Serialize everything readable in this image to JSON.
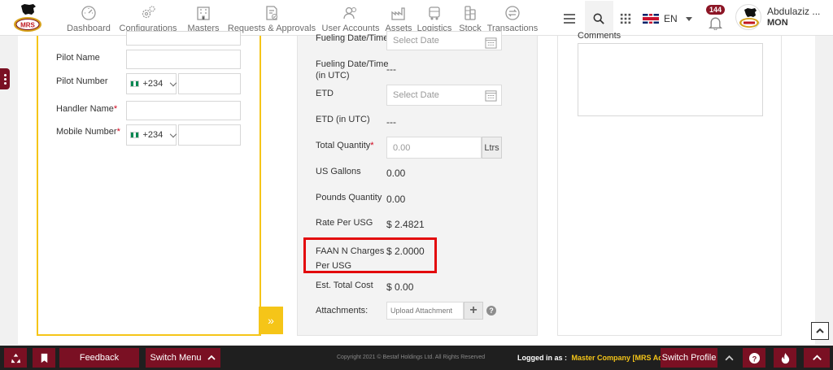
{
  "brand": {
    "logo_text": "MRS",
    "colors": {
      "maroon": "#7a1023",
      "accent_yellow": "#f5c518",
      "highlight_red": "#e3090c"
    }
  },
  "nav": {
    "items": [
      {
        "label": "Dashboard",
        "icon": "dashboard-icon"
      },
      {
        "label": "Configurations",
        "icon": "gears-icon"
      },
      {
        "label": "Masters",
        "icon": "building-icon"
      },
      {
        "label": "Requests & Approvals",
        "icon": "document-check-icon"
      },
      {
        "label": "User Accounts",
        "icon": "users-icon"
      },
      {
        "label": "Assets",
        "icon": "factory-icon"
      },
      {
        "label": "Logistics",
        "icon": "truck-icon"
      },
      {
        "label": "Stock",
        "icon": "barrels-icon"
      },
      {
        "label": "Transactions",
        "icon": "exchange-icon"
      }
    ]
  },
  "header": {
    "language": "EN",
    "notifications_count": "144",
    "user_name": "Abdulaziz ...",
    "user_code": "MON"
  },
  "left_form": {
    "pilot_name_label": "Pilot Name",
    "pilot_number_label": "Pilot Number",
    "pilot_number_code": "+234",
    "handler_name_label": "Handler Name",
    "mobile_number_label": "Mobile Number",
    "mobile_number_code": "+234",
    "collapse_glyph": "»"
  },
  "mid_form": {
    "fueling_datetime_label": "Fueling Date/Time",
    "fueling_datetime_placeholder": "Select Date",
    "fueling_datetime_utc_label_1": "Fueling Date/Time",
    "fueling_datetime_utc_label_2": "(in UTC)",
    "fueling_datetime_utc_value": "---",
    "etd_label": "ETD",
    "etd_placeholder": "Select Date",
    "etd_utc_label": "ETD (in UTC)",
    "etd_utc_value": "---",
    "total_quantity_label": "Total Quantity",
    "total_quantity_value": "0.00",
    "total_quantity_unit": "Ltrs",
    "us_gallons_label": "US Gallons",
    "us_gallons_value": "0.00",
    "pounds_quantity_label": "Pounds Quantity",
    "pounds_quantity_value": "0.00",
    "rate_per_usg_label": "Rate Per USG",
    "rate_per_usg_value": "$ 2.4821",
    "faan_label_1": "FAAN N Charges",
    "faan_label_2": "Per USG",
    "faan_value": "$ 2.0000",
    "est_total_cost_label": "Est. Total Cost",
    "est_total_cost_value": "$ 0.00",
    "attachments_label": "Attachments:",
    "upload_placeholder": "Upload Attachment"
  },
  "right_form": {
    "comments_label": "Comments"
  },
  "footer": {
    "feedback": "Feedback",
    "switch_menu": "Switch Menu",
    "copyright": "Copyright 2021 © Bestaf Holdings Ltd. All Rights Reserved",
    "logged_in_as": "Logged in as :",
    "company": "Master Company [MRS Admin]",
    "switch_profile": "Switch Profile"
  }
}
